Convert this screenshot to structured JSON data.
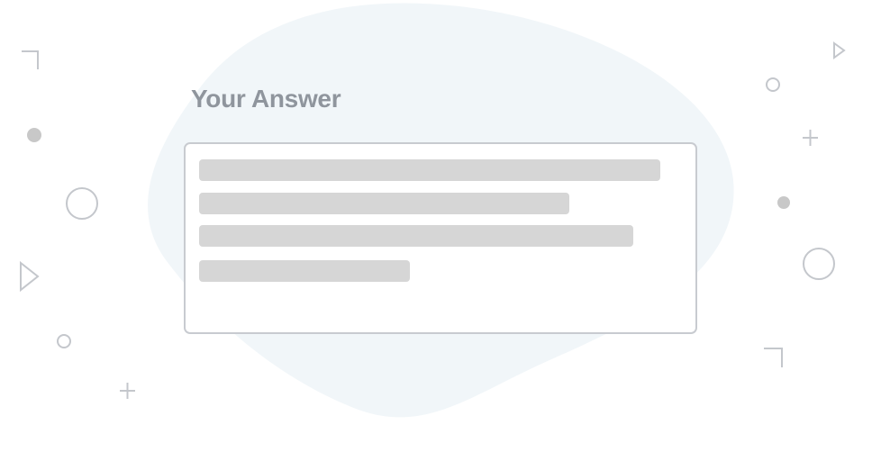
{
  "answer_panel": {
    "heading": "Your Answer",
    "placeholder_line_count": 4
  },
  "decorative_icons": [
    "corner-bracket-icon",
    "filled-dot-icon",
    "ring-icon",
    "triangle-outline-icon",
    "small-ring-icon",
    "plus-icon"
  ],
  "colors": {
    "heading_text": "#8f959d",
    "box_border": "#c8cbd0",
    "skeleton_line": "#d6d6d6",
    "blob_background": "#f1f6f9",
    "decor_shape": "#c4c7cc",
    "decor_dot": "#c8c8c8"
  }
}
